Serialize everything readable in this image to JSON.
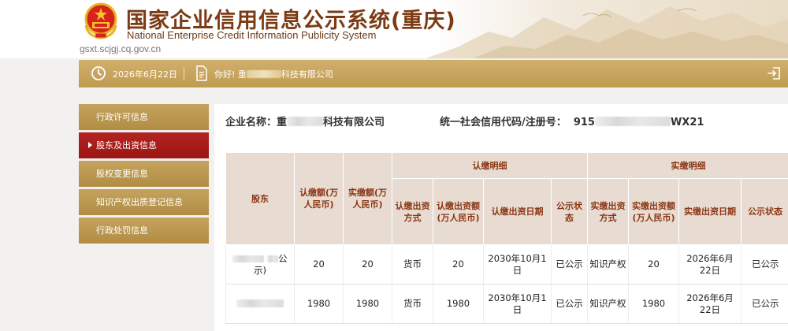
{
  "header": {
    "title_cn": "国家企业信用信息公示系统(重庆)",
    "title_en": "National Enterprise Credit Information Publicity System",
    "site_url": "gsxt.scjgj.cq.gov.cn"
  },
  "infobar": {
    "date": "2026年6月22日",
    "greeting_prefix": "你好!",
    "greeting_company_start": "重",
    "greeting_company_end": "科技有限公司",
    "icons": {
      "clock": "clock-icon",
      "doc": "document-icon",
      "logout": "logout-icon"
    }
  },
  "sidebar": {
    "items": [
      {
        "label": "行政许可信息",
        "active": false
      },
      {
        "label": "股东及出资信息",
        "active": true
      },
      {
        "label": "股权变更信息",
        "active": false
      },
      {
        "label": "知识产权出质登记信息",
        "active": false
      },
      {
        "label": "行政处罚信息",
        "active": false
      }
    ]
  },
  "main": {
    "company_label": "企业名称：",
    "company_start": "重",
    "company_end": "科技有限公司",
    "credit_label": "统一社会信用代码/注册号：",
    "credit_start": "915",
    "credit_end": "WX21",
    "table": {
      "headers": {
        "shareholder": "股东",
        "subscribed_amount": "认缴额(万人民币)",
        "paid_amount": "实缴额(万人民币)",
        "subscribed_detail": "认缴明细",
        "paid_detail": "实缴明细",
        "sub_method": "认缴出资方式",
        "sub_amount": "认缴出资额(万人民币)",
        "sub_date": "认缴出资日期",
        "sub_status": "公示状态",
        "paid_method": "实缴出资方式",
        "paid_amount_detail": "实缴出资额(万人民币)",
        "paid_date": "实缴出资日期",
        "paid_status": "公示状态"
      },
      "rows": [
        {
          "shareholder_visible": "公",
          "shareholder_tail": "示)",
          "subscribed": "20",
          "paid": "20",
          "sub_method": "货币",
          "sub_amount": "20",
          "sub_date": "2030年10月1日",
          "sub_status": "已公示",
          "paid_method": "知识产权",
          "paid_amount": "20",
          "paid_date": "2026年6月22日",
          "paid_status": "已公示"
        },
        {
          "shareholder_visible": "",
          "shareholder_tail": "",
          "subscribed": "1980",
          "paid": "1980",
          "sub_method": "货币",
          "sub_amount": "1980",
          "sub_date": "2030年10月1日",
          "sub_status": "已公示",
          "paid_method": "知识产权",
          "paid_amount": "1980",
          "paid_date": "2026年6月22日",
          "paid_status": "已公示"
        }
      ]
    }
  },
  "colors": {
    "header_title": "#7b3b14",
    "infobar": "#c5a35e",
    "sidebar_item": "#b8944c",
    "sidebar_active": "#a81c1a",
    "table_header_bg": "#e8dcd2",
    "table_header_text": "#8a3512"
  }
}
